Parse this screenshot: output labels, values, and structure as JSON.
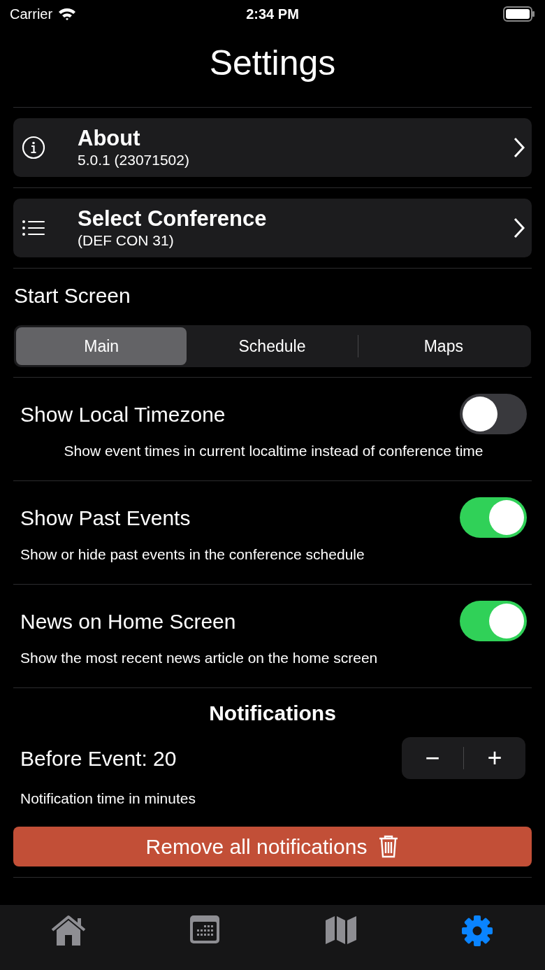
{
  "status_bar": {
    "carrier": "Carrier",
    "time": "2:34 PM"
  },
  "title": "Settings",
  "nav_rows": [
    {
      "kind": "info",
      "title": "About",
      "subtitle": "5.0.1 (23071502)"
    },
    {
      "kind": "list",
      "title": "Select Conference",
      "subtitle": "(DEF CON 31)"
    }
  ],
  "start_screen": {
    "label": "Start Screen",
    "segments": [
      {
        "label": "Main",
        "selected": true
      },
      {
        "label": "Schedule",
        "selected": false
      },
      {
        "label": "Maps",
        "selected": false
      }
    ]
  },
  "toggles": [
    {
      "title": "Show Local Timezone",
      "description": "Show event times in current localtime instead of conference time",
      "centered": true,
      "on": false
    },
    {
      "title": "Show Past Events",
      "description": "Show or hide past events in the conference schedule",
      "centered": false,
      "on": true
    },
    {
      "title": "News on Home Screen",
      "description": "Show the most recent news article on the home screen",
      "centered": false,
      "on": true
    }
  ],
  "notifications": {
    "heading": "Notifications",
    "before_event": "Before Event: 20",
    "stepper": {
      "minus": "−",
      "plus": "+"
    },
    "description": "Notification time in minutes",
    "remove_button": "Remove all notifications"
  },
  "tab_bar": [
    {
      "kind": "home",
      "selected": false
    },
    {
      "kind": "calendar",
      "selected": false
    },
    {
      "kind": "map",
      "selected": false
    },
    {
      "kind": "settings",
      "selected": true
    }
  ]
}
